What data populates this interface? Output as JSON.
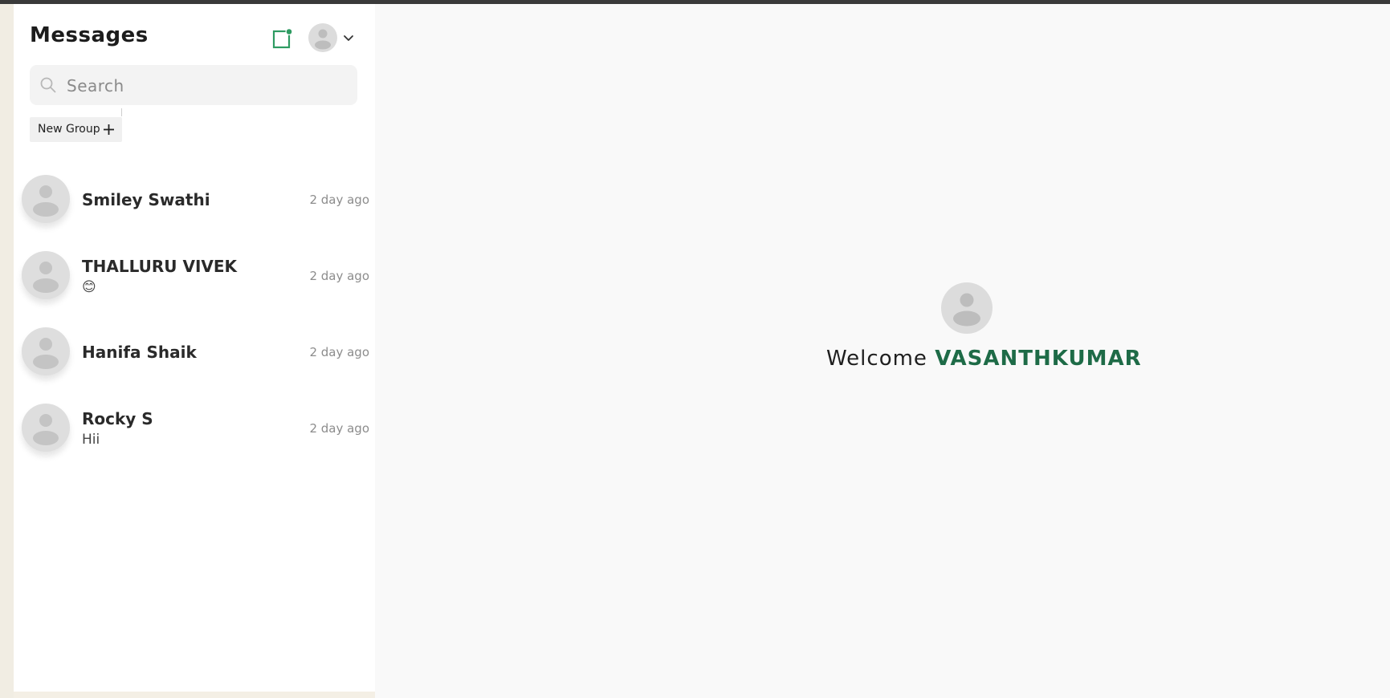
{
  "sidebar": {
    "title": "Messages",
    "search": {
      "placeholder": "Search",
      "value": ""
    },
    "new_group_label": "New Group",
    "conversations": [
      {
        "name": "Smiley Swathi",
        "preview": "",
        "time": "2 day ago"
      },
      {
        "name": "THALLURU VIVEK",
        "preview": "😊",
        "time": "2 day ago"
      },
      {
        "name": "Hanifa Shaik",
        "preview": "",
        "time": "2 day ago"
      },
      {
        "name": "Rocky S",
        "preview": "Hii",
        "time": "2 day ago"
      }
    ]
  },
  "welcome": {
    "greeting": "Welcome",
    "username": "VASANTHKUMAR"
  },
  "icons": {
    "new_chat": "new-chat-icon",
    "search": "search-icon",
    "plus": "plus-icon",
    "chevron": "chevron-down-icon",
    "avatar": "avatar-placeholder"
  },
  "colors": {
    "accent": "#1e6b47",
    "new_chat_icon": "#2e9b62",
    "new_chat_dot": "#2e9b62"
  }
}
